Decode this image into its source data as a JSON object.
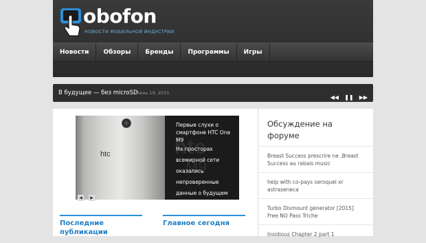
{
  "logo": {
    "wordmark": "obofon",
    "tagline": "НОВОСТИ МОБИЛЬНОЙ ИНДУСТРИИ",
    "icon": "hand-phone-icon"
  },
  "nav": {
    "items": [
      "Новости",
      "Обзоры",
      "Бренды",
      "Программы",
      "Игры"
    ]
  },
  "ticker": {
    "title": "В будущее — без microSD",
    "date": "Июнь 19, 2015",
    "controls": {
      "prev": "◀◀",
      "pause": "❚❚",
      "next": "▶▶"
    }
  },
  "slider": {
    "phone_brand": "htc",
    "caption_title": "Первые слухи о смартфоне HTC One M9",
    "caption_text": "На просторах всемирной сети оказались непроверенные данные о будущем флагманском",
    "bg_text1": "htc",
    "bg_text2": "M9",
    "nav": {
      "prev": "◀",
      "next": "▶"
    }
  },
  "sections": {
    "latest": "Последние публикации",
    "main_today": "Главное сегодня"
  },
  "sidebar": {
    "title": "Обсуждение на форуме",
    "items": [
      "Breast Success prescrire ne ,Breast Success au rabais music",
      "help with co-pays seroquel xr astraseneca",
      "Turbo Dismount generator [2015] Free NO Pass Triche",
      "Insidious Chapter 2 part 1"
    ]
  },
  "colors": {
    "accent": "#1e7fc6",
    "header": "#2f2f2f",
    "background": "#e4e4e4"
  }
}
